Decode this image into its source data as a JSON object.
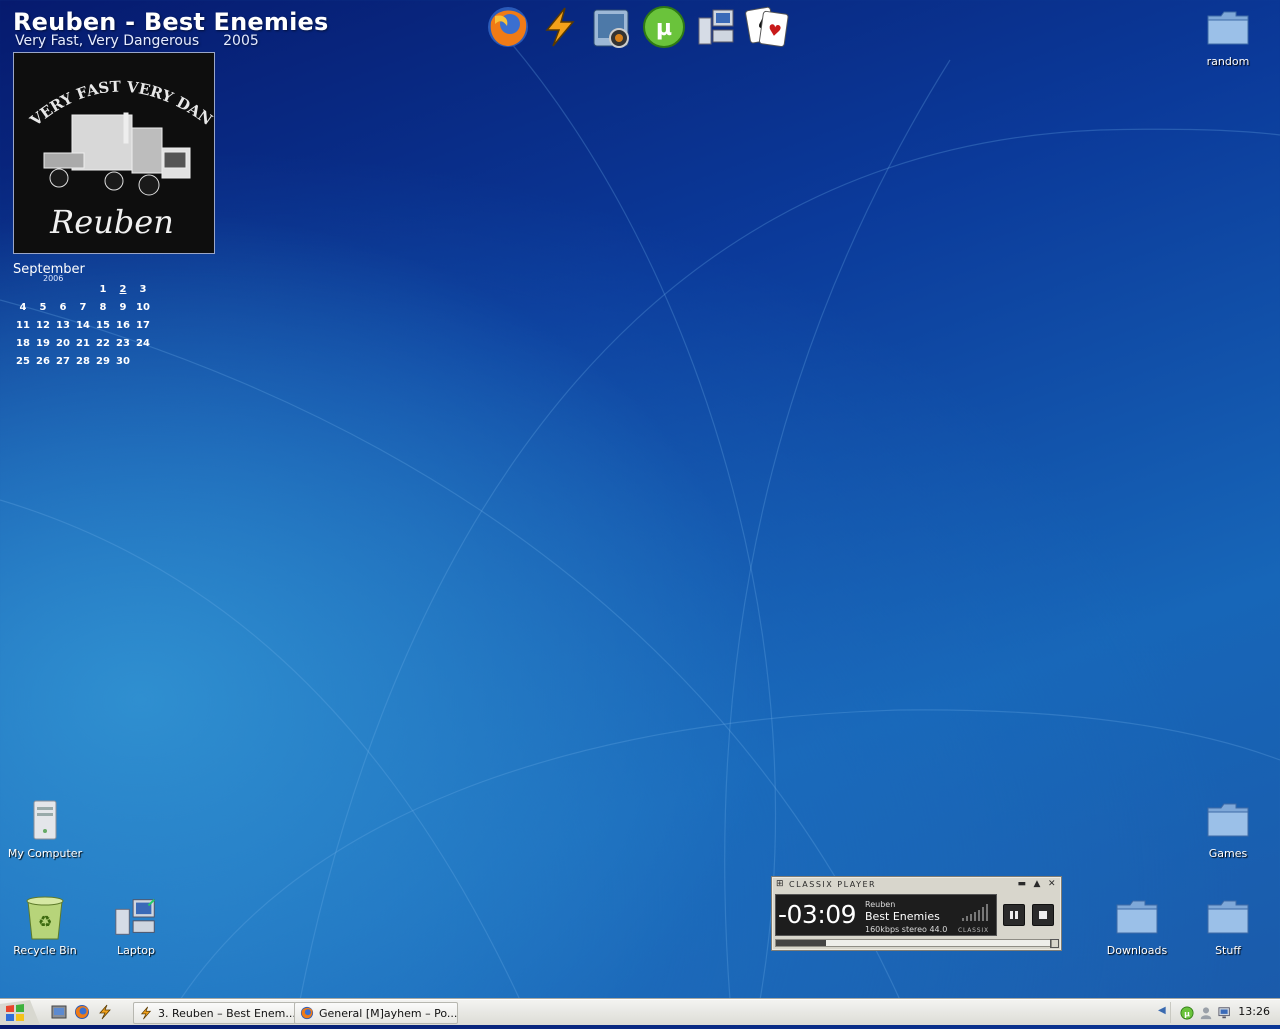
{
  "now_playing": {
    "title": "Reuben - Best Enemies",
    "album": "Very Fast, Very Dangerous",
    "year": "2005",
    "cover": {
      "text_top": "VERY FAST VERY DANGEROUS",
      "text_bottom": "Reuben"
    }
  },
  "calendar": {
    "month": "September",
    "year": "2006",
    "today": "2",
    "weeks": [
      [
        "",
        "",
        "",
        "",
        "1",
        "2",
        "3"
      ],
      [
        "4",
        "5",
        "6",
        "7",
        "8",
        "9",
        "10"
      ],
      [
        "11",
        "12",
        "13",
        "14",
        "15",
        "16",
        "17"
      ],
      [
        "18",
        "19",
        "20",
        "21",
        "22",
        "23",
        "24"
      ],
      [
        "25",
        "26",
        "27",
        "28",
        "29",
        "30",
        ""
      ]
    ]
  },
  "dock": [
    "firefox-icon",
    "winamp-icon",
    "photo-viewer-icon",
    "utorrent-icon",
    "network-icon",
    "solitaire-icon"
  ],
  "desktop_icons": {
    "random": "random",
    "my_computer": "My Computer",
    "recycle_bin": "Recycle Bin",
    "laptop": "Laptop",
    "games": "Games",
    "downloads": "Downloads",
    "stuff": "Stuff"
  },
  "player": {
    "title": "CLASSIX PLAYER",
    "time": "-03:09",
    "artist": "Reuben",
    "track": "Best Enemies",
    "info": "160kbps stereo 44.0",
    "brand": "CLASSIX",
    "progress": 0.18
  },
  "taskbar": {
    "tasks": [
      {
        "label": "3. Reuben – Best Enem...",
        "icon": "winamp-icon"
      },
      {
        "label": "General [M]ayhem – Po...",
        "icon": "firefox-icon"
      }
    ],
    "clock": "13:26"
  },
  "colors": {
    "desktop_dark": "#061a6e",
    "desktop_light": "#2f8fd0",
    "folder": "#7fa8d8",
    "taskbar": "#ebebe7"
  }
}
